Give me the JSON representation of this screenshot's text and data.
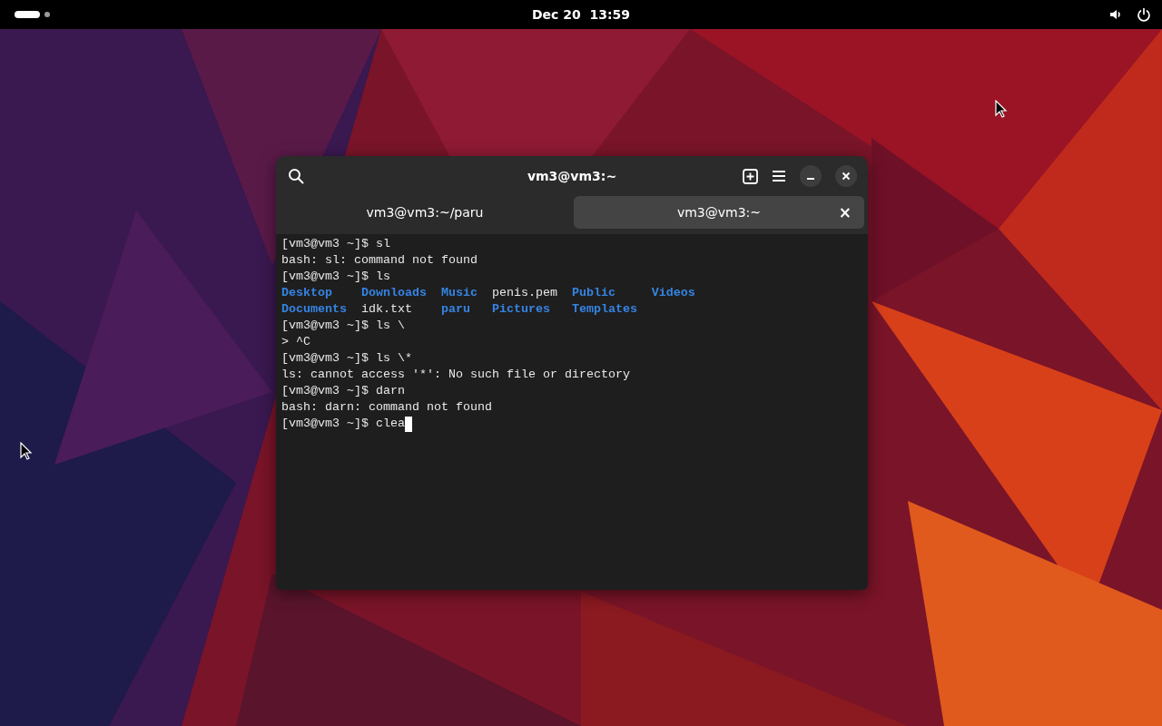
{
  "top_bar": {
    "clock": "Dec 20  13:59"
  },
  "window": {
    "title": "vm3@vm3:~"
  },
  "tabs": [
    {
      "label": "vm3@vm3:~/paru",
      "selected": false
    },
    {
      "label": "vm3@vm3:~",
      "selected": true,
      "close": "×"
    }
  ],
  "terminal": {
    "lines": [
      {
        "kind": "text",
        "text": "[vm3@vm3 ~]$ sl"
      },
      {
        "kind": "text",
        "text": "bash: sl: command not found"
      },
      {
        "kind": "text",
        "text": "[vm3@vm3 ~]$ ls"
      },
      {
        "kind": "listing",
        "rows": [
          [
            {
              "name": "Desktop",
              "directory": true
            },
            {
              "name": "Downloads",
              "directory": true
            },
            {
              "name": "Music",
              "directory": true
            },
            {
              "name": "penis.pem",
              "directory": false
            },
            {
              "name": "Public",
              "directory": true
            },
            {
              "name": "Videos",
              "directory": true
            }
          ],
          [
            {
              "name": "Documents",
              "directory": true
            },
            {
              "name": "idk.txt",
              "directory": false
            },
            {
              "name": "paru",
              "directory": true
            },
            {
              "name": "Pictures",
              "directory": true
            },
            {
              "name": "Templates",
              "directory": true
            }
          ]
        ]
      },
      {
        "kind": "text",
        "text": "[vm3@vm3 ~]$ ls \\"
      },
      {
        "kind": "text",
        "text": "> ^C"
      },
      {
        "kind": "text",
        "text": "[vm3@vm3 ~]$ ls \\*"
      },
      {
        "kind": "text",
        "text": "ls: cannot access '*': No such file or directory"
      },
      {
        "kind": "text",
        "text": "[vm3@vm3 ~]$ darn"
      },
      {
        "kind": "text",
        "text": "bash: darn: command not found"
      },
      {
        "kind": "text",
        "text": "[vm3@vm3 ~]$ clea",
        "cursor": true
      }
    ]
  }
}
